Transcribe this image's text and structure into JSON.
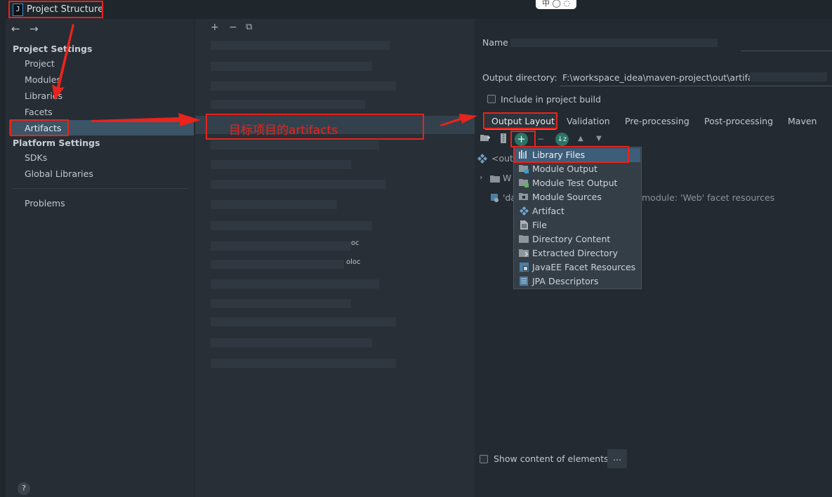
{
  "window": {
    "title": "Project Structure",
    "app_icon_glyph": "J",
    "top_widget_text": "中 ◯ ◌"
  },
  "nav": {
    "back": "←",
    "forward": "→"
  },
  "sidebar": {
    "project_settings_header": "Project Settings",
    "project_settings_items": [
      "Project",
      "Modules",
      "Libraries",
      "Facets",
      "Artifacts"
    ],
    "platform_settings_header": "Platform Settings",
    "platform_settings_items": [
      "SDKs",
      "Global Libraries"
    ],
    "problems": "Problems",
    "help": "?"
  },
  "middle": {
    "toolbar": [
      "+",
      "−",
      "⧉"
    ],
    "callout_text": "目标项目的artifacts",
    "partial_text_1": "oc",
    "partial_text_2": "oloc"
  },
  "right": {
    "name_label": "Name",
    "output_dir_label": "Output directory:",
    "output_dir_value": "F:\\workspace_idea\\maven-project\\out\\artifact",
    "include_label": "Include in project build",
    "tabs": [
      "Output Layout",
      "Validation",
      "Pre-processing",
      "Post-processing",
      "Maven"
    ],
    "active_tab": "Output Layout",
    "tree": {
      "root": "<outp",
      "row2": "W",
      "row3": "'da",
      "resources": "module: 'Web' facet resources"
    },
    "show_content_label": "Show content of elements",
    "more_button": "..."
  },
  "popup": {
    "items": [
      {
        "label": "Library Files",
        "icon": "library-icon"
      },
      {
        "label": "Module Output",
        "icon": "module-output-icon"
      },
      {
        "label": "Module Test Output",
        "icon": "module-test-output-icon"
      },
      {
        "label": "Module Sources",
        "icon": "module-sources-icon"
      },
      {
        "label": "Artifact",
        "icon": "artifact-icon"
      },
      {
        "label": "File",
        "icon": "file-icon"
      },
      {
        "label": "Directory Content",
        "icon": "directory-icon"
      },
      {
        "label": "Extracted Directory",
        "icon": "extracted-directory-icon"
      },
      {
        "label": "JavaEE Facet Resources",
        "icon": "javaee-icon"
      },
      {
        "label": "JPA Descriptors",
        "icon": "jpa-icon"
      }
    ],
    "selected": "Library Files"
  },
  "colors": {
    "annotation": "#e8241c",
    "selection": "#3b5466",
    "accent": "#4f9fd7",
    "add_button": "#2b7466"
  }
}
